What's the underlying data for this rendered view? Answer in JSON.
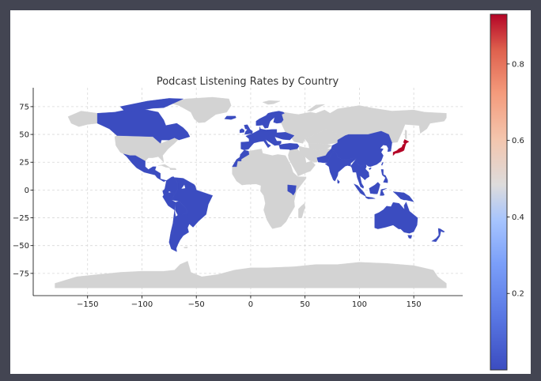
{
  "chart_data": {
    "type": "choropleth",
    "title": "Podcast Listening Rates by Country",
    "xlabel": "",
    "ylabel": "",
    "xlim": [
      -200,
      195
    ],
    "ylim": [
      -95,
      92
    ],
    "xticks": [
      -150,
      -100,
      -50,
      0,
      50,
      100,
      150
    ],
    "yticks": [
      75,
      50,
      25,
      0,
      -25,
      -50,
      -75
    ],
    "grid": true,
    "grid_style": "dashed",
    "colormap": "coolwarm",
    "colorbar": {
      "range": [
        0.0,
        0.93
      ],
      "ticks": [
        0.2,
        0.4,
        0.6,
        0.8
      ]
    },
    "no_data_color": "#d3d3d3",
    "low_color": "#3b4cc0",
    "high_color": "#b40426",
    "regions": [
      {
        "name": "Canada",
        "value": 0.0
      },
      {
        "name": "United States",
        "value": null
      },
      {
        "name": "Mexico",
        "value": 0.0
      },
      {
        "name": "Central America",
        "value": 0.0
      },
      {
        "name": "Colombia",
        "value": 0.0
      },
      {
        "name": "Brazil",
        "value": 0.0
      },
      {
        "name": "Peru",
        "value": 0.0
      },
      {
        "name": "Argentina",
        "value": 0.0
      },
      {
        "name": "Chile",
        "value": 0.0
      },
      {
        "name": "Greenland",
        "value": null
      },
      {
        "name": "Iceland",
        "value": 0.0
      },
      {
        "name": "United Kingdom",
        "value": 0.0
      },
      {
        "name": "Western Europe",
        "value": 0.0
      },
      {
        "name": "Scandinavia",
        "value": 0.0
      },
      {
        "name": "Russia",
        "value": null
      },
      {
        "name": "Turkey",
        "value": 0.0
      },
      {
        "name": "Morocco",
        "value": 0.0
      },
      {
        "name": "Africa",
        "value": null
      },
      {
        "name": "Kenya",
        "value": 0.0
      },
      {
        "name": "Middle East",
        "value": null
      },
      {
        "name": "India",
        "value": 0.0
      },
      {
        "name": "China",
        "value": 0.0
      },
      {
        "name": "Southeast Asia",
        "value": 0.0
      },
      {
        "name": "Indonesia",
        "value": 0.0
      },
      {
        "name": "Philippines",
        "value": 0.0
      },
      {
        "name": "Japan",
        "value": 0.93
      },
      {
        "name": "Australia",
        "value": 0.0
      },
      {
        "name": "New Zealand",
        "value": 0.0
      },
      {
        "name": "Antarctica",
        "value": null
      }
    ]
  }
}
